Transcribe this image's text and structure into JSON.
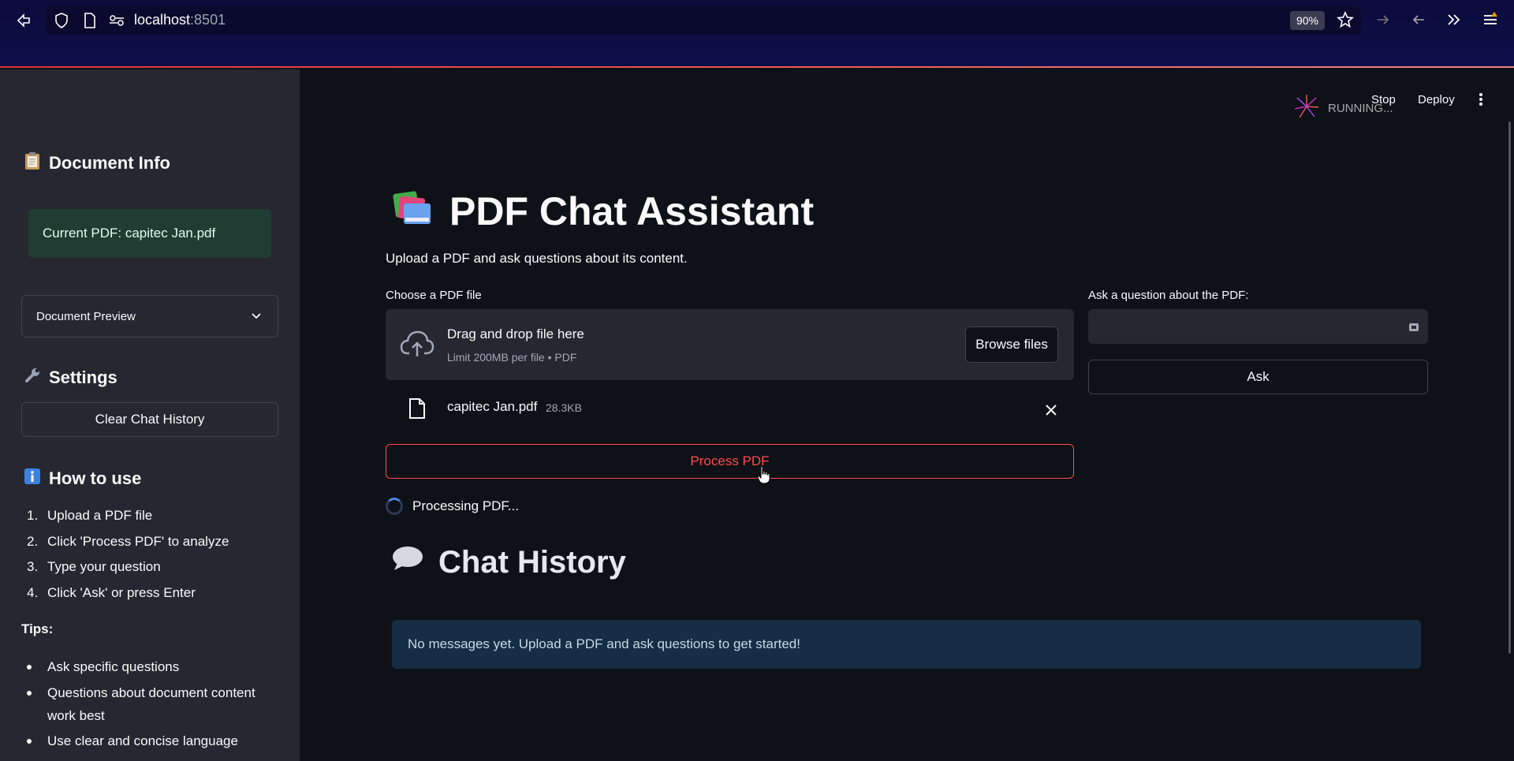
{
  "browser": {
    "url_host": "localhost",
    "url_port": ":8501",
    "zoom": "90%"
  },
  "app_toolbar": {
    "status": "RUNNING...",
    "stop_label": "Stop",
    "deploy_label": "Deploy"
  },
  "sidebar": {
    "doc_info_heading": "Document Info",
    "current_pdf": "Current PDF: capitec Jan.pdf",
    "preview_label": "Document Preview",
    "settings_heading": "Settings",
    "clear_button": "Clear Chat History",
    "howto_heading": "How to use",
    "steps": [
      {
        "n": "1.",
        "text": "Upload a PDF file"
      },
      {
        "n": "2.",
        "text": "Click 'Process PDF' to analyze"
      },
      {
        "n": "3.",
        "text": "Type your question"
      },
      {
        "n": "4.",
        "text": "Click 'Ask' or press Enter"
      }
    ],
    "tips_heading": "Tips:",
    "tips": [
      "Ask specific questions",
      "Questions about document content work best",
      "Use clear and concise language"
    ]
  },
  "main": {
    "title": "PDF Chat Assistant",
    "subtitle": "Upload a PDF and ask questions about its content.",
    "uploader_label": "Choose a PDF file",
    "drop_text": "Drag and drop file here",
    "limit_text": "Limit 200MB per file • PDF",
    "browse_label": "Browse files",
    "file_name": "capitec Jan.pdf",
    "file_size": "28.3KB",
    "process_label": "Process PDF",
    "processing_text": "Processing PDF...",
    "question_label": "Ask a question about the PDF:",
    "question_value": "",
    "ask_label": "Ask",
    "chat_heading": "Chat History",
    "empty_message": "No messages yet. Upload a PDF and ask questions to get started!"
  },
  "colors": {
    "primary": "#ff4b4b",
    "sidebar_bg": "#262730",
    "app_bg": "#0e1117",
    "success_bg": "#1f3d32",
    "info_bg": "#172d43"
  }
}
